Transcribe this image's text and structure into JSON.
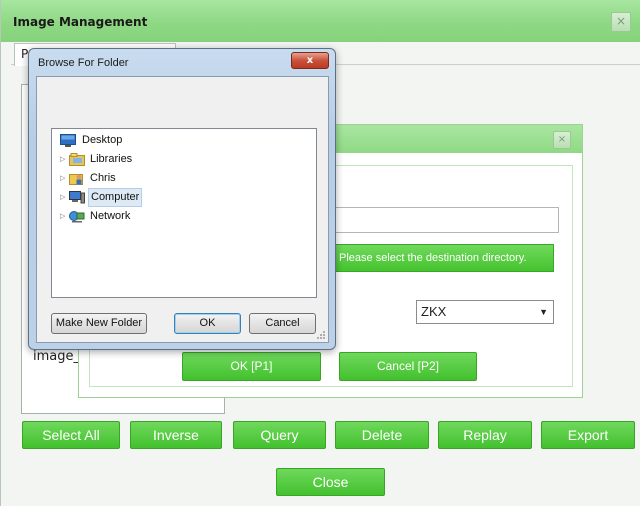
{
  "main_window": {
    "title": "Image Management",
    "close_glyph": "×",
    "tab_label": "P",
    "left_panel_text": "image_",
    "action_buttons": [
      "Select All",
      "Inverse",
      "Query",
      "Delete",
      "Replay",
      "Export"
    ],
    "close_button": "Close"
  },
  "export_dialog": {
    "close_glyph": "×",
    "destination_hint": "Please select the destination directory.",
    "format_value": "ZKX",
    "ok_button": "OK [P1]",
    "cancel_button": "Cancel [P2]"
  },
  "browse_dialog": {
    "title": "Browse For Folder",
    "close_glyph": "x",
    "tree": [
      {
        "label": "Desktop",
        "icon": "desktop-icon"
      },
      {
        "label": "Libraries",
        "icon": "libraries-icon"
      },
      {
        "label": "Chris",
        "icon": "user-folder-icon"
      },
      {
        "label": "Computer",
        "icon": "computer-icon"
      },
      {
        "label": "Network",
        "icon": "network-icon"
      }
    ],
    "make_new_folder": "Make New Folder",
    "ok": "OK",
    "cancel": "Cancel"
  },
  "colors": {
    "accent_green": "#4cc535",
    "titlebar_green": "#8ed884",
    "window_blue": "#bcd1e8"
  }
}
